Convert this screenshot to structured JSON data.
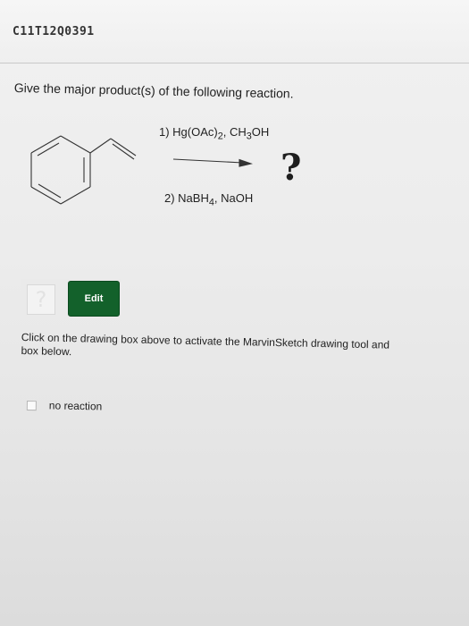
{
  "problem": {
    "id": "C11T12Q0391",
    "question": "Give the major product(s) of the following reaction."
  },
  "reaction": {
    "step1": "1) Hg(OAc)2, CH3OH",
    "step2": "2) NaBH4, NaOH",
    "product": "?",
    "reactant_structure": "styrene"
  },
  "answer": {
    "placeholder": "?",
    "edit_label": "Edit",
    "instructions": "Click on the drawing box above to activate the MarvinSketch drawing tool and",
    "instructions_line2": "box below.",
    "no_reaction_label": "no reaction"
  },
  "colors": {
    "edit_button": "#13612b",
    "background": "#ececec"
  }
}
